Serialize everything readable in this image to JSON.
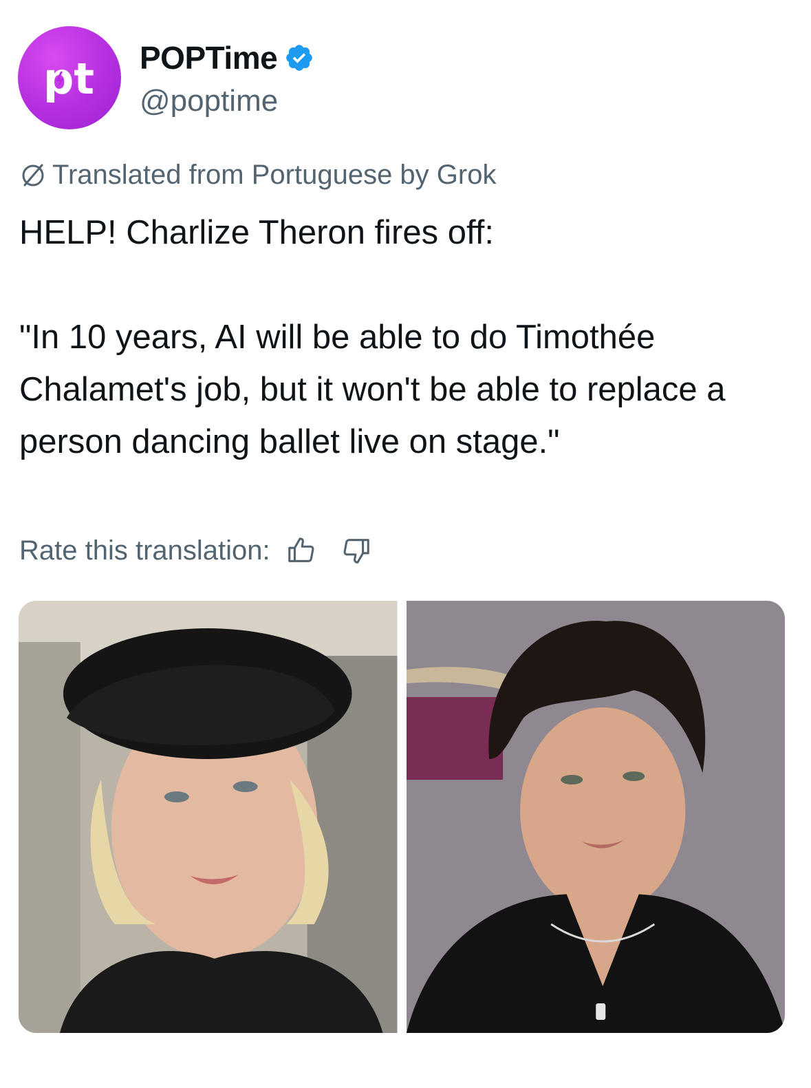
{
  "author": {
    "display_name": "POPTime",
    "handle": "@poptime",
    "avatar_text": "pt",
    "avatar_color": "#b52fe0",
    "verified_color": "#1d9bf0"
  },
  "translation": {
    "notice": "Translated from Portuguese by Grok",
    "icon": "globe-icon"
  },
  "tweet": {
    "text": "HELP! Charlize Theron fires off:\n\n\"In 10 years, AI will be able to do Timothée Chalamet's job, but it won't be able to replace a person dancing ballet live on stage.\""
  },
  "rating": {
    "label": "Rate this translation:",
    "up_icon": "thumbs-up-icon",
    "down_icon": "thumbs-down-icon"
  },
  "media": [
    {
      "name": "photo-charlize-theron"
    },
    {
      "name": "photo-timothee-chalamet"
    }
  ]
}
